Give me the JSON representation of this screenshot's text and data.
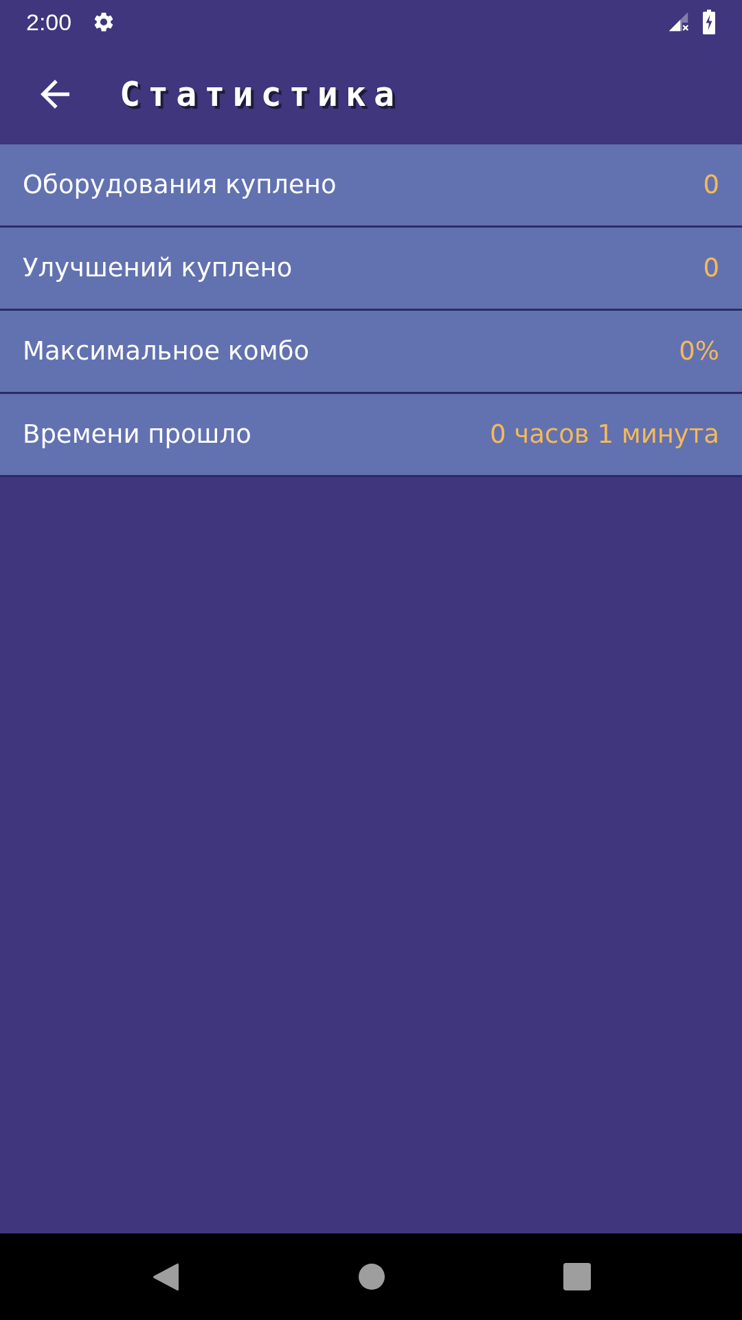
{
  "status_bar": {
    "time": "2:00"
  },
  "toolbar": {
    "title": "Статистика"
  },
  "stats": [
    {
      "label": "Оборудования куплено",
      "value": "0"
    },
    {
      "label": "Улучшений куплено",
      "value": "0"
    },
    {
      "label": "Максимальное комбо",
      "value": "0%"
    },
    {
      "label": "Времени прошло",
      "value": "0 часов 1 минута"
    }
  ]
}
